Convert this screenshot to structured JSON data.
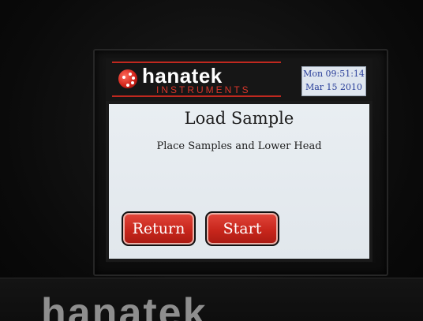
{
  "brand": {
    "name": "hanatek",
    "subtitle": "INSTRUMENTS",
    "accent_color": "#c0281f"
  },
  "clock": {
    "time": "Mon 09:51:14",
    "date": "Mar 15  2010"
  },
  "panel": {
    "title": "Load Sample",
    "message": "Place Samples and Lower Head"
  },
  "buttons": {
    "return_label": "Return",
    "start_label": "Start",
    "color": "#c8261c"
  },
  "case": {
    "brand_text": "hanatek"
  },
  "icons": {
    "logo": "hanatek-logo-ball-icon"
  }
}
